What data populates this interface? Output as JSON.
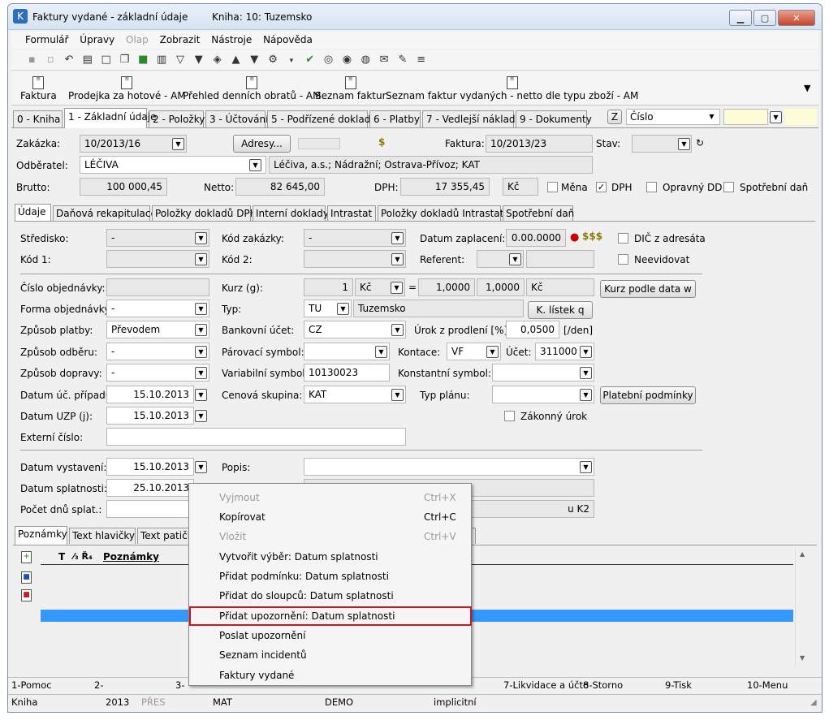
{
  "window": {
    "title": "Faktury vydané - základní údaje",
    "book": "Kniha: 10: Tuzemsko"
  },
  "menu": [
    "Formulář",
    "Úpravy",
    "Olap",
    "Zobrazit",
    "Nástroje",
    "Nápověda"
  ],
  "toolbar_reports": [
    "Faktura",
    "Prodejka za hotové - AM",
    "Přehled denních obratů - AM",
    "Seznam faktur",
    "Seznam faktur vydaných - netto dle typu zboží - AM"
  ],
  "tabs": [
    "0 - Kniha",
    "1 - Základní údaje",
    "2 - Položky",
    "3 - Účtování",
    "5 - Podřízené doklady",
    "6 - Platby",
    "7 - Vedlejší náklady",
    "9 - Dokumenty"
  ],
  "sort": {
    "z_label": "Z",
    "field": "Číslo"
  },
  "header": {
    "zakazka_label": "Zakázka:",
    "zakazka": "10/2013/16",
    "adresy_button": "Adresy...",
    "faktura_label": "Faktura:",
    "faktura": "10/2013/23",
    "stav_label": "Stav:",
    "odberatel_label": "Odběratel:",
    "odberatel": "LÉČIVA",
    "odberatel_full": "Léčiva, a.s.; Nádražní; Ostrava-Přívoz; KAT",
    "brutto_label": "Brutto:",
    "brutto": "100 000,45",
    "netto_label": "Netto:",
    "netto": "82 645,00",
    "dph_label": "DPH:",
    "dph": "17 355,45",
    "currency": "Kč",
    "mena_label": "Měna",
    "dph_check_label": "DPH",
    "dph_checked": "✓",
    "opravny_label": "Opravný DD",
    "spotrebni_label": "Spotřební daň"
  },
  "subtabs": [
    "Údaje",
    "Daňová rekapitulace",
    "Položky dokladů DPH",
    "Interní doklady",
    "Intrastat",
    "Položky dokladů Intrastatu",
    "Spotřební daň"
  ],
  "form": {
    "stredisko_label": "Středisko:",
    "stredisko": "-",
    "kod_zakazky_label": "Kód zakázky:",
    "kod_zakazky": "-",
    "datum_zaplaceni_label": "Datum zaplacení:",
    "datum_zaplaceni": "0.00.0000",
    "dic_label": "DIČ z adresáta",
    "kod1_label": "Kód 1:",
    "kod2_label": "Kód 2:",
    "referent_label": "Referent:",
    "neevidovat_label": "Neevidovat",
    "cislo_obj_label": "Číslo objednávky:",
    "kurz_label": "Kurz (g):",
    "kurz_qty": "1",
    "kurz_cur": "Kč",
    "eq": "=",
    "kurz_val1": "1,0000",
    "kurz_val2": "1,0000",
    "kurz_cur2": "Kč",
    "kurz_button": "Kurz podle data w",
    "forma_obj_label": "Forma objednávky:",
    "forma_obj": "-",
    "typ_label": "Typ:",
    "typ_code": "TU",
    "typ_name": "Tuzemsko",
    "listek_button": "K. lístek q",
    "zpusob_platby_label": "Způsob platby:",
    "zpusob_platby": "Převodem",
    "bankovni_label": "Bankovní účet:",
    "bankovni": "CZ",
    "urok_label": "Úrok z prodlení [%]:",
    "urok": "0,0500",
    "urok_unit": "[/den]",
    "zpusob_odberu_label": "Způsob odběru:",
    "zpusob_odberu": "-",
    "parovaci_label": "Párovací symbol:",
    "kontace_label": "Kontace:",
    "kontace": "VF",
    "ucet_label": "Účet:",
    "ucet": "311000",
    "zpusob_dopravy_label": "Způsob dopravy:",
    "zpusob_dopravy": "-",
    "variabilni_label": "Variabilní symbol:",
    "variabilni": "10130023",
    "konstantni_label": "Konstantní symbol:",
    "datum_uc_label": "Datum úč. případu:",
    "datum_uc": "15.10.2013",
    "cenova_label": "Cenová skupina:",
    "cenova": "KAT",
    "typ_planu_label": "Typ plánu:",
    "platebni_button": "Platební podmínky",
    "datum_uzp_label": "Datum UZP (j):",
    "datum_uzp": "15.10.2013",
    "zakonny_label": "Zákonný úrok",
    "externi_label": "Externí číslo:",
    "datum_vystaveni_label": "Datum vystavení:",
    "datum_vystaveni": "15.10.2013",
    "popis_label": "Popis:",
    "datum_splatnosti_label": "Datum splatnosti:",
    "datum_splatnosti": "25.10.2013",
    "pocet_dnu_label": "Počet dnů splat.:",
    "hidden_fragment": "u K2"
  },
  "notes": {
    "tabs": [
      "Poznámky",
      "Text hlavičky",
      "Text patičk"
    ],
    "header_t": "T",
    "header_mid": "⁄₃ Ř₄",
    "header_label": "Poznámky"
  },
  "context_menu": [
    {
      "label": "Vyjmout",
      "shortcut": "Ctrl+X",
      "disabled": true
    },
    {
      "label": "Kopírovat",
      "shortcut": "Ctrl+C",
      "disabled": false
    },
    {
      "label": "Vložit",
      "shortcut": "Ctrl+V",
      "disabled": true
    },
    {
      "label": "Vytvořit výběr: Datum splatnosti",
      "shortcut": "",
      "disabled": false
    },
    {
      "label": "Přidat podmínku: Datum splatnosti",
      "shortcut": "",
      "disabled": false
    },
    {
      "label": "Přidat do sloupců: Datum splatnosti",
      "shortcut": "",
      "disabled": false
    },
    {
      "label": "Přidat upozornění: Datum splatnosti",
      "shortcut": "",
      "disabled": false,
      "highlighted": true
    },
    {
      "label": "Poslat upozornění",
      "shortcut": "",
      "disabled": false
    },
    {
      "label": "Seznam incidentů",
      "shortcut": "",
      "disabled": false
    },
    {
      "label": "Faktury vydané",
      "shortcut": "",
      "disabled": false
    }
  ],
  "fkeys": [
    "1-Pomoc",
    "2-",
    "3-",
    "7-Likvidace a účto",
    "8-Storno",
    "9-Tisk",
    "10-Menu"
  ],
  "status": [
    "Kniha",
    "2013",
    "PŘES",
    "MAT",
    "DEMO",
    "implicitní"
  ]
}
